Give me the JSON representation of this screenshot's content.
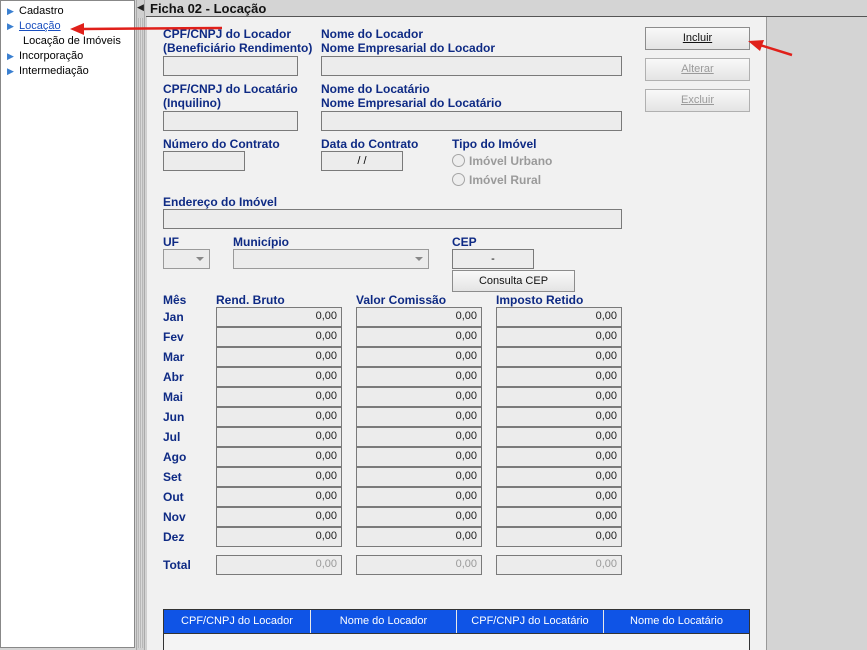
{
  "sidebar": {
    "items": [
      {
        "label": "Cadastro"
      },
      {
        "label": "Locação"
      },
      {
        "label": "Locação de Imóveis"
      },
      {
        "label": "Incorporação"
      },
      {
        "label": "Intermediação"
      }
    ]
  },
  "header": {
    "title": "Ficha 02 - Locação"
  },
  "form": {
    "locador_cpf_label_1": "CPF/CNPJ do Locador",
    "locador_cpf_label_2": "(Beneficiário Rendimento)",
    "locador_nome_label_1": "Nome do Locador",
    "locador_nome_label_2": "Nome Empresarial do Locador",
    "locatario_cpf_label_1": "CPF/CNPJ do Locatário",
    "locatario_cpf_label_2": "(Inquilino)",
    "locatario_nome_label_1": "Nome do Locatário",
    "locatario_nome_label_2": "Nome Empresarial do Locatário",
    "contrato_label": "Número do Contrato",
    "data_label": "Data do Contrato",
    "data_value": "/ /",
    "tipo_label": "Tipo do Imóvel",
    "tipo_urbano": "Imóvel Urbano",
    "tipo_rural": "Imóvel Rural",
    "endereco_label": "Endereço do Imóvel",
    "uf_label": "UF",
    "municipio_label": "Município",
    "cep_label": "CEP",
    "cep_value": "-",
    "consulta_cep": "Consulta CEP"
  },
  "buttons": {
    "incluir": "Incluir",
    "alterar": "Alterar",
    "excluir": "Excluir"
  },
  "table": {
    "headers": {
      "mes": "Mês",
      "rend": "Rend. Bruto",
      "comissao": "Valor Comissão",
      "imposto": "Imposto Retido"
    },
    "months": [
      "Jan",
      "Fev",
      "Mar",
      "Abr",
      "Mai",
      "Jun",
      "Jul",
      "Ago",
      "Set",
      "Out",
      "Nov",
      "Dez"
    ],
    "rows": [
      [
        "0,00",
        "0,00",
        "0,00"
      ],
      [
        "0,00",
        "0,00",
        "0,00"
      ],
      [
        "0,00",
        "0,00",
        "0,00"
      ],
      [
        "0,00",
        "0,00",
        "0,00"
      ],
      [
        "0,00",
        "0,00",
        "0,00"
      ],
      [
        "0,00",
        "0,00",
        "0,00"
      ],
      [
        "0,00",
        "0,00",
        "0,00"
      ],
      [
        "0,00",
        "0,00",
        "0,00"
      ],
      [
        "0,00",
        "0,00",
        "0,00"
      ],
      [
        "0,00",
        "0,00",
        "0,00"
      ],
      [
        "0,00",
        "0,00",
        "0,00"
      ],
      [
        "0,00",
        "0,00",
        "0,00"
      ]
    ],
    "total_label": "Total",
    "totals": [
      "0,00",
      "0,00",
      "0,00"
    ]
  },
  "grid": {
    "columns": [
      "CPF/CNPJ do Locador",
      "Nome do Locador",
      "CPF/CNPJ do Locatário",
      "Nome do Locatário"
    ]
  },
  "colors": {
    "accent": "#0f54e6",
    "label": "#0e2a84",
    "link": "#1a4fbf",
    "annotation": "#e0201a"
  }
}
